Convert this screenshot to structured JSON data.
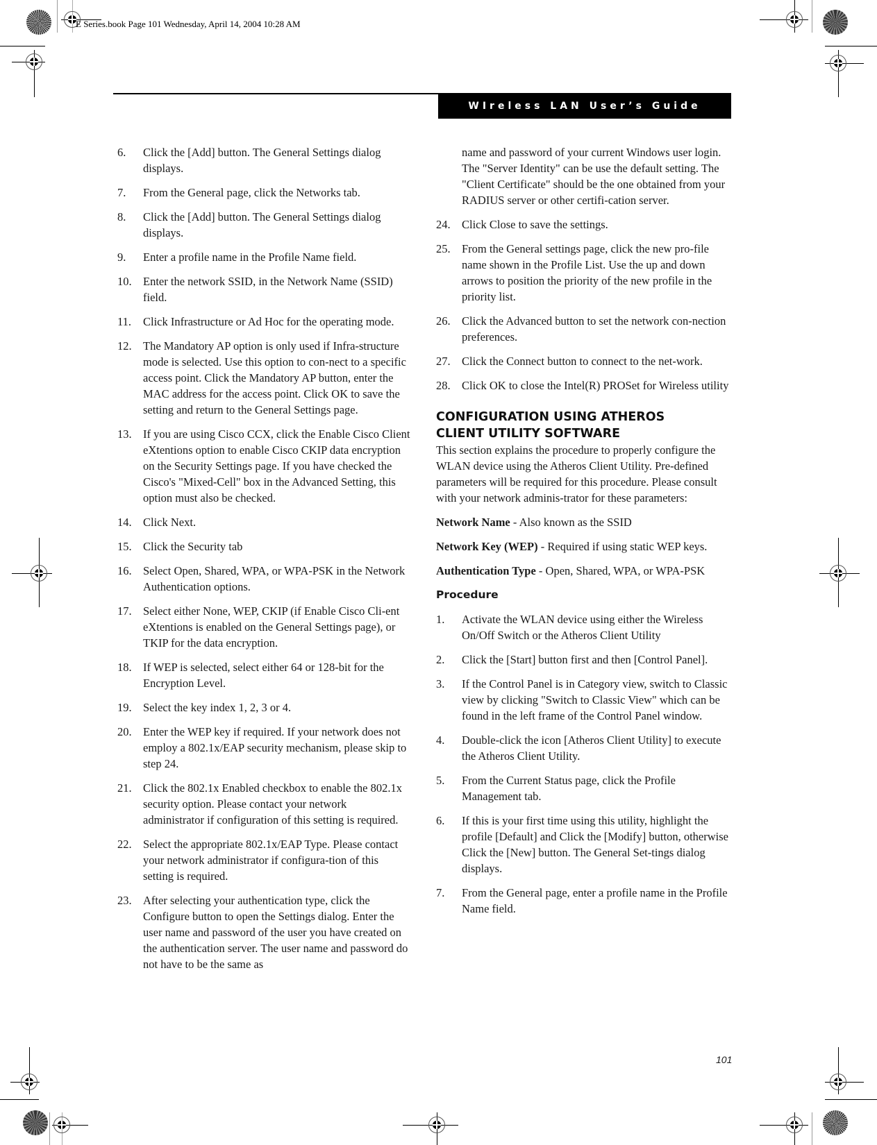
{
  "slug": "E Series.book  Page 101  Wednesday, April 14, 2004  10:28 AM",
  "header": {
    "title": "WIreless LAN User’s Guide"
  },
  "left_column": {
    "steps": [
      {
        "num": "6.",
        "text": "Click the [Add] button. The General Settings dialog displays."
      },
      {
        "num": "7.",
        "text": "From the General page, click the Networks tab."
      },
      {
        "num": "8.",
        "text": "Click the [Add] button. The General Settings dialog displays."
      },
      {
        "num": "9.",
        "text": "Enter a profile name in the Profile Name field."
      },
      {
        "num": "10.",
        "text": "Enter the network SSID, in the Network Name (SSID) field."
      },
      {
        "num": "11.",
        "text": "Click Infrastructure or Ad Hoc for the operating mode."
      },
      {
        "num": "12.",
        "text": "The Mandatory AP option is only used if Infra-structure mode is selected. Use this option to con-nect to a specific access point. Click the Mandatory AP button, enter the MAC address for the access point. Click OK to save the setting and return to the General Settings page."
      },
      {
        "num": "13.",
        "text": "If you are using Cisco CCX, click the Enable Cisco Client eXtentions option to enable Cisco CKIP data encryption on the Security Settings page. If you have checked the Cisco's \"Mixed-Cell\" box in the Advanced Setting, this option must also be checked."
      },
      {
        "num": "14.",
        "text": "Click Next."
      },
      {
        "num": "15.",
        "text": "Click the Security tab"
      },
      {
        "num": "16.",
        "text": "Select Open, Shared, WPA, or WPA-PSK in the Network Authentication options."
      },
      {
        "num": "17.",
        "text": "Select either None, WEP, CKIP (if Enable Cisco Cli-ent eXtentions is enabled on the General Settings page), or TKIP for the data encryption."
      },
      {
        "num": "18.",
        "text": "If WEP is selected, select either 64 or 128-bit for the Encryption Level."
      },
      {
        "num": "19.",
        "text": "Select the key index 1, 2, 3 or 4."
      },
      {
        "num": "20.",
        "text": "Enter the WEP key if required. If your network does not employ a 802.1x/EAP security mechanism, please skip to step 24."
      },
      {
        "num": "21.",
        "text": "Click the 802.1x Enabled checkbox to enable the 802.1x security option. Please contact your network administrator if configuration of this setting is required."
      },
      {
        "num": "22.",
        "text": "Select the appropriate 802.1x/EAP Type. Please contact your network administrator if configura-tion of this setting is required."
      },
      {
        "num": "23.",
        "text": "After selecting your authentication type, click the Configure button to open the Settings dialog. Enter the user name and password of the user you have created on the authentication server. The user name and password do not have to be the same as"
      }
    ]
  },
  "right_column": {
    "continuation": "name and password of your current Windows user login. The \"Server Identity\" can be use the default setting. The \"Client Certificate\" should be the one obtained from your RADIUS server or other certifi-cation server.",
    "steps": [
      {
        "num": "24.",
        "text": "Click Close to save the settings."
      },
      {
        "num": "25.",
        "text": "From the General settings page, click the new pro-file name shown in the Profile List. Use the up and down arrows to position the priority of the new profile in the priority list."
      },
      {
        "num": "26.",
        "text": "Click the Advanced button to set the network con-nection preferences."
      },
      {
        "num": "27.",
        "text": "Click the Connect button to connect to the net-work."
      },
      {
        "num": "28.",
        "text": "Click OK to close the Intel(R) PROSet for Wireless utility"
      }
    ],
    "section": {
      "title_line1": "CONFIGURATION USING ATHEROS",
      "title_line2": "CLIENT UTILITY SOFTWARE",
      "intro": "This section explains the procedure to properly configure the WLAN device using the Atheros Client Utility. Pre-defined parameters will be required for this procedure. Please consult with your network adminis-trator for these parameters:",
      "params": [
        {
          "label": "Network Name",
          "text": " - Also known as the SSID"
        },
        {
          "label": "Network Key (WEP)",
          "text": " - Required if using static WEP keys."
        },
        {
          "label": "Authentication Type",
          "text": " - Open, Shared, WPA, or WPA-PSK"
        }
      ],
      "procedure_heading": "Procedure",
      "procedure_steps": [
        {
          "num": "1.",
          "text": "Activate the WLAN device using either the Wireless On/Off Switch or the Atheros Client Utility"
        },
        {
          "num": "2.",
          "text": "Click the [Start] button first and then [Control Panel]."
        },
        {
          "num": "3.",
          "text": "If the Control Panel is in Category view, switch to Classic view by clicking \"Switch to Classic View\" which can be found in the left frame of the Control Panel window."
        },
        {
          "num": "4.",
          "text": "Double-click the icon [Atheros Client Utility] to execute the Atheros Client Utility."
        },
        {
          "num": "5.",
          "text": "From the Current Status page, click the Profile Management tab."
        },
        {
          "num": "6.",
          "text": "If this is your first time using this utility, highlight the profile [Default] and Click the [Modify] button, otherwise Click the [New] button. The General Set-tings dialog displays."
        },
        {
          "num": "7.",
          "text": "From the General page, enter a profile name in the Profile Name field."
        }
      ]
    }
  },
  "page_number": "101"
}
